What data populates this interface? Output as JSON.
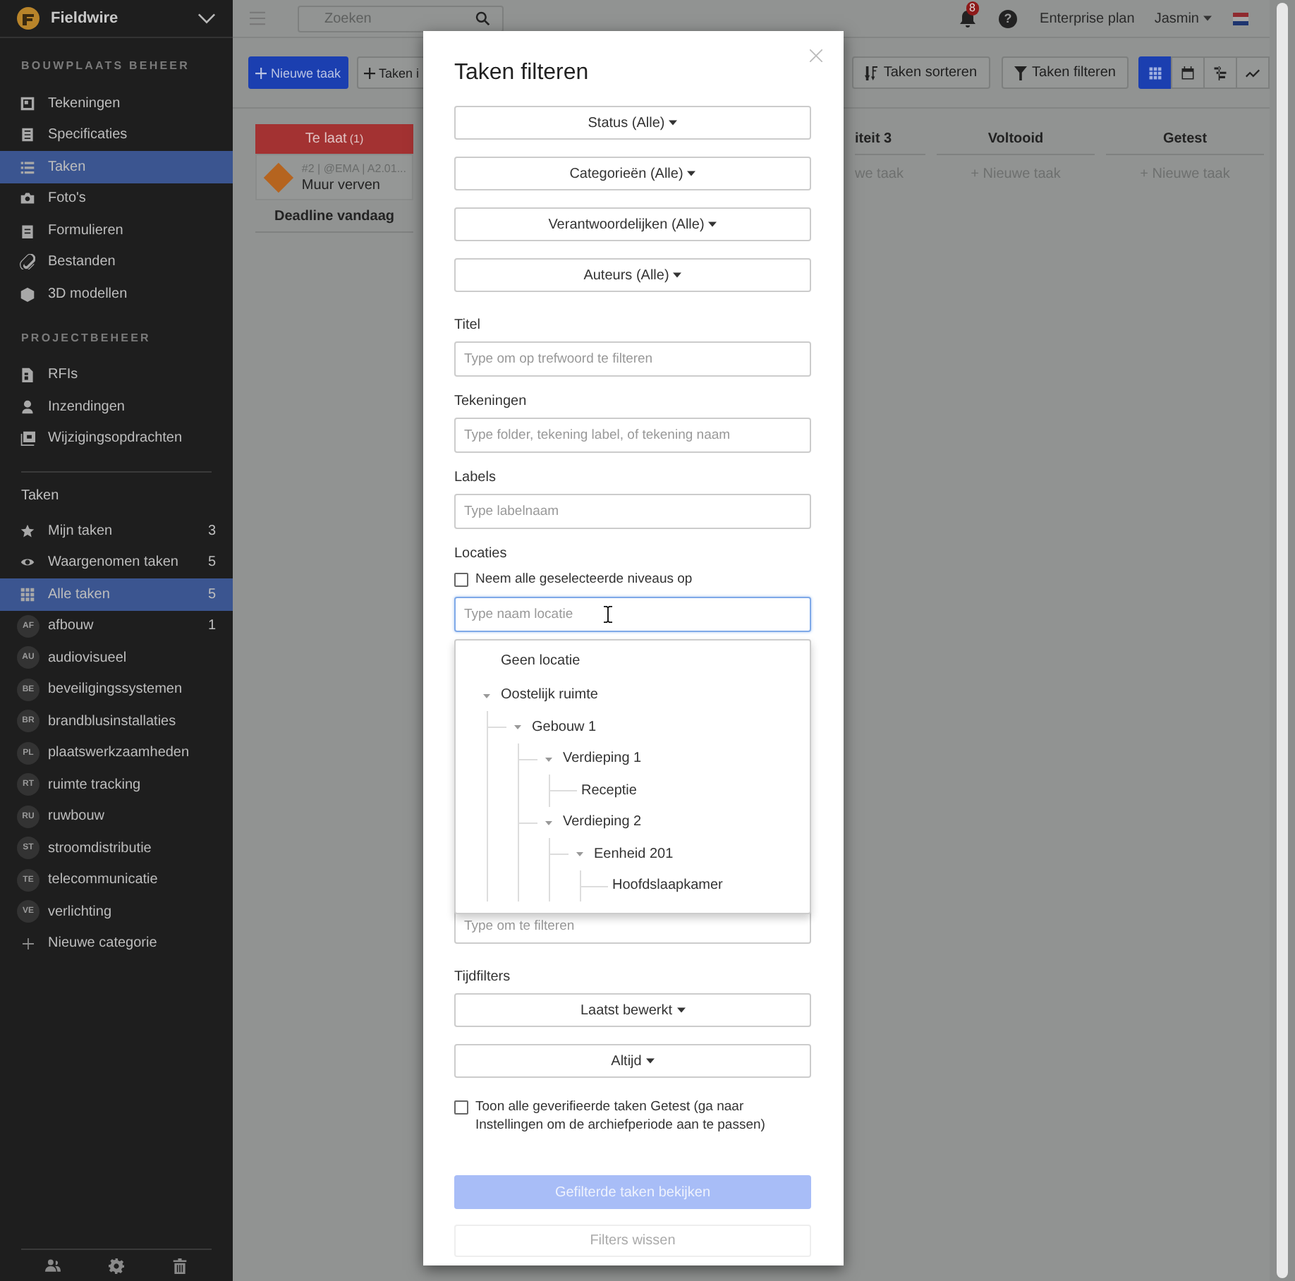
{
  "app": {
    "name": "Fieldwire"
  },
  "sidebar": {
    "sections": [
      {
        "title": "BOUWPLAATS BEHEER",
        "items": [
          {
            "label": "Tekeningen",
            "selected": false
          },
          {
            "label": "Specificaties",
            "selected": false
          },
          {
            "label": "Taken",
            "selected": true
          },
          {
            "label": "Foto's",
            "selected": false
          },
          {
            "label": "Formulieren",
            "selected": false
          },
          {
            "label": "Bestanden",
            "selected": false
          },
          {
            "label": "3D modellen",
            "selected": false
          }
        ]
      },
      {
        "title": "PROJECTBEHEER",
        "items": [
          {
            "label": "RFIs",
            "selected": false
          },
          {
            "label": "Inzendingen",
            "selected": false
          },
          {
            "label": "Wijzigingsopdrachten",
            "selected": false
          }
        ]
      }
    ],
    "tasks": {
      "title": "Taken",
      "items": [
        {
          "label": "Mijn taken",
          "count": "3",
          "selected": false
        },
        {
          "label": "Waargenomen taken",
          "count": "5",
          "selected": false
        },
        {
          "label": "Alle taken",
          "count": "5",
          "selected": true
        }
      ],
      "categories": [
        {
          "badge": "AF",
          "label": "afbouw",
          "count": "1"
        },
        {
          "badge": "AU",
          "label": "audiovisueel"
        },
        {
          "badge": "BE",
          "label": "beveiligingssystemen"
        },
        {
          "badge": "BR",
          "label": "brandblusinstallaties"
        },
        {
          "badge": "PL",
          "label": "plaatswerkzaamheden"
        },
        {
          "badge": "RT",
          "label": "ruimte tracking"
        },
        {
          "badge": "RU",
          "label": "ruwbouw"
        },
        {
          "badge": "ST",
          "label": "stroomdistributie"
        },
        {
          "badge": "TE",
          "label": "telecommunicatie"
        },
        {
          "badge": "VE",
          "label": "verlichting"
        }
      ],
      "add_category": "Nieuwe categorie"
    }
  },
  "topbar": {
    "search_placeholder": "Zoeken",
    "notifications": "8",
    "help": "?",
    "plan": "Enterprise plan",
    "user": "Jasmin"
  },
  "toolbar": {
    "left": [
      {
        "label": "Nieuwe taak",
        "kind": "primary"
      },
      {
        "label": "Taken i",
        "kind": "default"
      }
    ],
    "right": [
      {
        "label": "Taken sorteren",
        "kind": "sort"
      },
      {
        "label": "Taken filteren",
        "kind": "filter"
      }
    ],
    "views": [
      {
        "kind": "grid",
        "selected": true
      },
      {
        "kind": "calendar",
        "selected": false
      },
      {
        "kind": "gantt",
        "selected": false
      },
      {
        "kind": "chart",
        "selected": false
      }
    ]
  },
  "board": {
    "columns": [
      {
        "title": "Te laat",
        "count": "(1)",
        "kind": "overdue",
        "cards": [
          {
            "meta": "#2 | @EMA | A2.01...",
            "title": "Muur verven",
            "color": "#b5641f"
          }
        ],
        "footer": "Deadline vandaag"
      }
    ],
    "right_columns": [
      {
        "title": "iteit 3",
        "add": "we taak"
      },
      {
        "title": "Voltooid",
        "add": "+ Nieuwe taak"
      },
      {
        "title": "Getest",
        "add": "+ Nieuwe taak"
      }
    ]
  },
  "modal": {
    "title": "Taken filteren",
    "dropdowns": [
      "Status (Alle)",
      "Categorieën (Alle)",
      "Verantwoordelijken (Alle)",
      "Auteurs (Alle)"
    ],
    "fields": [
      {
        "label": "Titel",
        "placeholder": "Type om op trefwoord te filteren"
      },
      {
        "label": "Tekeningen",
        "placeholder": "Type folder, tekening label, of tekening naam"
      },
      {
        "label": "Labels",
        "placeholder": "Type labelnaam"
      }
    ],
    "locations": {
      "label": "Locaties",
      "checkbox": {
        "label": "Neem alle geselecteerde niveaus op",
        "checked": false
      },
      "placeholder": "Type naam locatie",
      "focused": true,
      "tree": [
        {
          "label": "Geen locatie"
        },
        {
          "label": "Oostelijk ruimte",
          "expanded": true,
          "children": [
            {
              "label": "Gebouw 1",
              "expanded": true,
              "children": [
                {
                  "label": "Verdieping 1",
                  "expanded": true,
                  "children": [
                    {
                      "label": "Receptie"
                    }
                  ]
                },
                {
                  "label": "Verdieping 2",
                  "expanded": true,
                  "children": [
                    {
                      "label": "Eenheid 201",
                      "expanded": true,
                      "children": [
                        {
                          "label": "Hoofdslaapkamer"
                        }
                      ]
                    }
                  ]
                }
              ]
            }
          ]
        }
      ]
    },
    "hidden_field": {
      "placeholder": "Type om te filteren"
    },
    "time_filters": {
      "label": "Tijdfilters",
      "dropdowns": [
        "Laatst bewerkt",
        "Altijd"
      ]
    },
    "archive_checkbox": {
      "label": "Toon alle geverifieerde taken Getest (ga naar Instellingen om de archiefperiode aan te passen)",
      "checked": false
    },
    "apply_button": {
      "label": "Gefilterde taken bekijken",
      "disabled": true
    },
    "clear_button": {
      "label": "Filters wissen",
      "disabled": true
    }
  }
}
